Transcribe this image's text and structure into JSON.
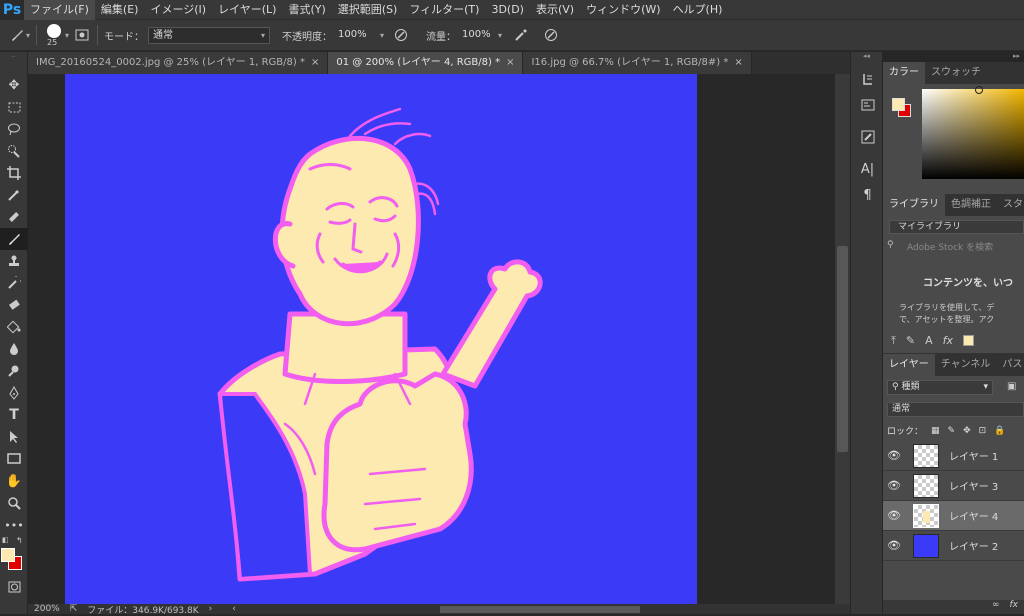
{
  "app": {
    "logo": "Ps"
  },
  "menubar": {
    "items": [
      "ファイル(F)",
      "編集(E)",
      "イメージ(I)",
      "レイヤー(L)",
      "書式(Y)",
      "選択範囲(S)",
      "フィルター(T)",
      "3D(D)",
      "表示(V)",
      "ウィンドウ(W)",
      "ヘルプ(H)"
    ]
  },
  "options": {
    "brush_size": "25",
    "mode_label": "モード：",
    "mode_value": "通常",
    "opacity_label": "不透明度：",
    "opacity_value": "100%",
    "flow_label": "流量：",
    "flow_value": "100%"
  },
  "tabs": [
    {
      "label": "IMG_20160524_0002.jpg @ 25% (レイヤー 1, RGB/8) *",
      "close": "×",
      "active": false
    },
    {
      "label": "01 @ 200% (レイヤー 4, RGB/8) *",
      "close": "×",
      "active": true
    },
    {
      "label": "I16.jpg @ 66.7% (レイヤー 1, RGB/8#) *",
      "close": "×",
      "active": false
    }
  ],
  "status": {
    "zoom": "200%",
    "file_info": "ファイル：346.9K/693.8K"
  },
  "colors": {
    "canvas_bg": "#3b3bf7",
    "foreground": "#fdeab0",
    "background": "#e00000",
    "skin": "#fdeab0",
    "outline": "#f15ef0"
  },
  "color_panel": {
    "tabs": [
      "カラー",
      "スウォッチ"
    ]
  },
  "library_panel": {
    "tabs": [
      "ライブラリ",
      "色調補正",
      "スタ"
    ],
    "library_select": "マイライブラリ",
    "search_placeholder": "Adobe Stock を検索",
    "heading": "コンテンツを、いつ",
    "body_line1": "ライブラリを使用して、デ",
    "body_line2": "で、アセットを整理。アク"
  },
  "layers_panel": {
    "tabs": [
      "レイヤー",
      "チャンネル",
      "パス"
    ],
    "filter_label": "種類",
    "blend_mode": "通常",
    "lock_label": "ロック：",
    "layers": [
      {
        "name": "レイヤー 1",
        "thumb": "checker",
        "selected": false
      },
      {
        "name": "レイヤー 3",
        "thumb": "checker",
        "selected": false
      },
      {
        "name": "レイヤー 4",
        "thumb": "skin",
        "selected": true
      },
      {
        "name": "レイヤー 2",
        "thumb": "blue",
        "selected": false
      }
    ]
  }
}
